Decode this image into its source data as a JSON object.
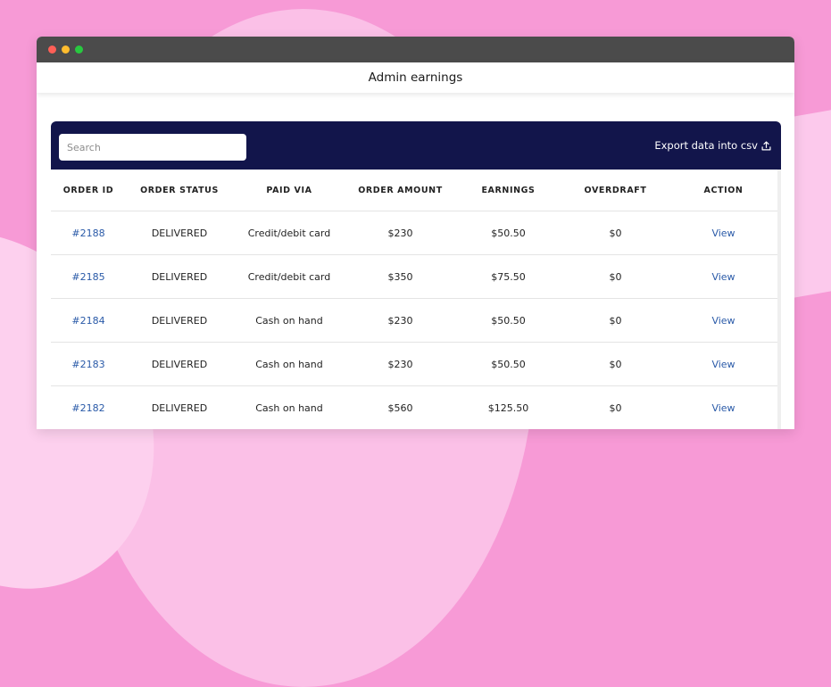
{
  "header": {
    "title": "Admin earnings"
  },
  "toolbar": {
    "search_placeholder": "Search",
    "export_label": "Export data into csv"
  },
  "table": {
    "columns": [
      "ORDER ID",
      "ORDER STATUS",
      "PAID VIA",
      "ORDER AMOUNT",
      "EARNINGS",
      "OVERDRAFT",
      "ACTION"
    ],
    "rows": [
      {
        "order_id": "#2188",
        "status": "DELIVERED",
        "paid_via": "Credit/debit card",
        "amount": "$230",
        "earnings": "$50.50",
        "overdraft": "$0",
        "action": "View"
      },
      {
        "order_id": "#2185",
        "status": "DELIVERED",
        "paid_via": "Credit/debit card",
        "amount": "$350",
        "earnings": "$75.50",
        "overdraft": "$0",
        "action": "View"
      },
      {
        "order_id": "#2184",
        "status": "DELIVERED",
        "paid_via": "Cash on hand",
        "amount": "$230",
        "earnings": "$50.50",
        "overdraft": "$0",
        "action": "View"
      },
      {
        "order_id": "#2183",
        "status": "DELIVERED",
        "paid_via": "Cash on hand",
        "amount": "$230",
        "earnings": "$50.50",
        "overdraft": "$0",
        "action": "View"
      },
      {
        "order_id": "#2182",
        "status": "DELIVERED",
        "paid_via": "Cash on hand",
        "amount": "$560",
        "earnings": "$125.50",
        "overdraft": "$0",
        "action": "View"
      }
    ]
  },
  "icons": {
    "export": "upload-icon"
  },
  "colors": {
    "background": "#f79ad6",
    "toolbar": "#12154b",
    "link": "#2a5aa8"
  }
}
